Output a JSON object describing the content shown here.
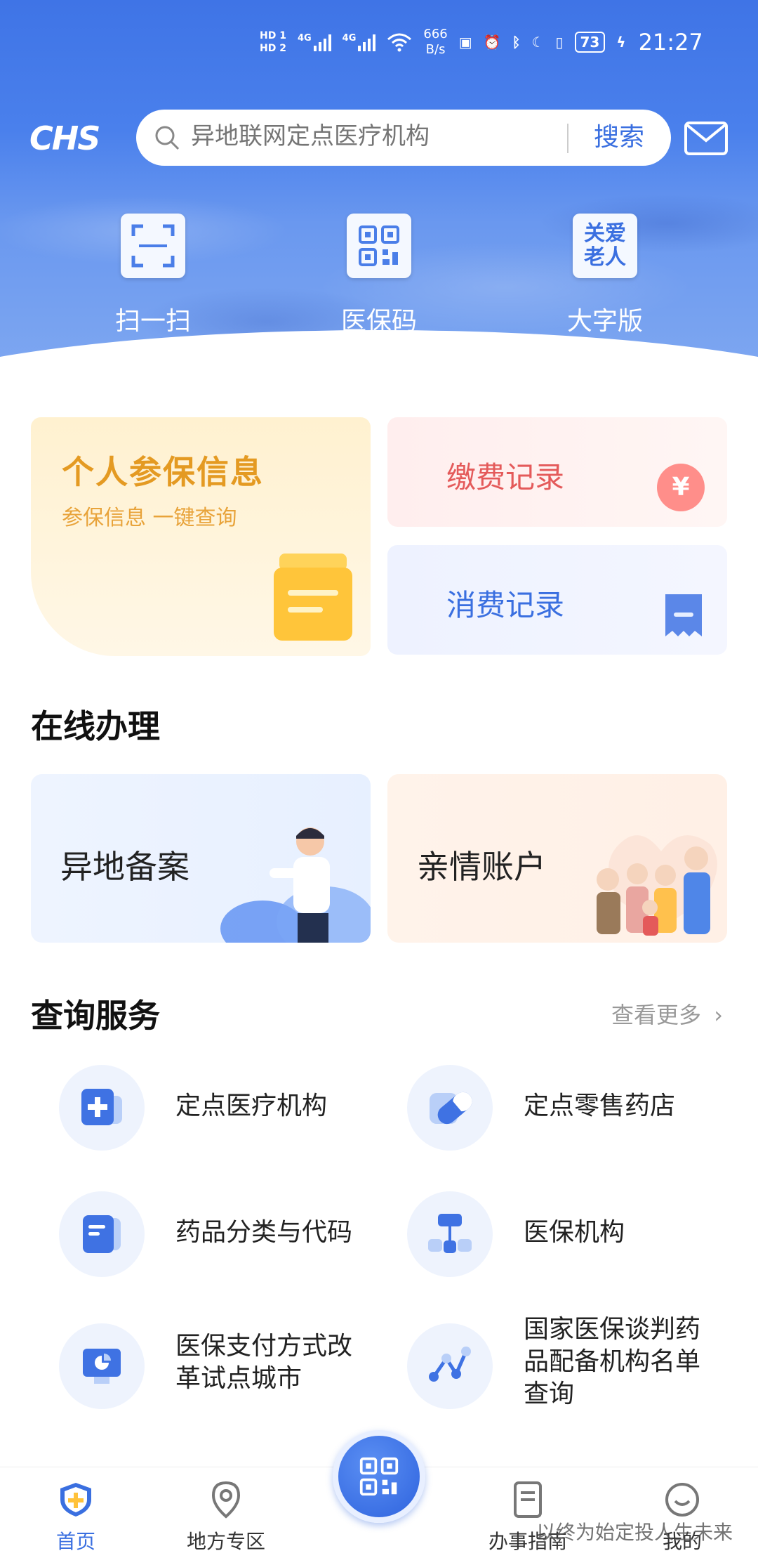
{
  "status_bar": {
    "hd1": "HD 1",
    "hd2": "HD 2",
    "net1": "4G",
    "net2": "4G",
    "speed_value": "666",
    "speed_unit": "B/s",
    "battery": "73",
    "time": "21:27"
  },
  "header": {
    "logo": "CHS",
    "search": {
      "placeholder": "异地联网定点医疗机构",
      "button": "搜索"
    }
  },
  "quick_actions": [
    {
      "label": "扫一扫"
    },
    {
      "label": "医保码"
    },
    {
      "label": "大字版",
      "tile_text_line1": "关爱",
      "tile_text_line2": "老人"
    }
  ],
  "cards": {
    "insurance_title": "个人参保信息",
    "insurance_sub": "参保信息 一键查询",
    "payment": "缴费记录",
    "payment_badge": "¥",
    "spending": "消费记录"
  },
  "online": {
    "title": "在线办理",
    "items": [
      {
        "label": "异地备案"
      },
      {
        "label": "亲情账户"
      }
    ]
  },
  "query": {
    "title": "查询服务",
    "more": "查看更多",
    "items": [
      {
        "line1": "定点医疗机构",
        "line2": "",
        "line3": ""
      },
      {
        "line1": "定点零售药店",
        "line2": "",
        "line3": ""
      },
      {
        "line1": "药品分类与代码",
        "line2": "",
        "line3": ""
      },
      {
        "line1": "医保机构",
        "line2": "",
        "line3": ""
      },
      {
        "line1": "医保支付方式改",
        "line2": "革试点城市",
        "line3": ""
      },
      {
        "line1": "国家医保谈判药",
        "line2": "品配备机构名单",
        "line3": "查询"
      }
    ]
  },
  "bottom_nav": [
    {
      "label": "首页"
    },
    {
      "label": "地方专区"
    },
    {
      "label": "办事指南"
    },
    {
      "label": "我的"
    }
  ],
  "watermark": "以终为始定投人生未来",
  "colors": {
    "primary": "#3a6fe0",
    "header": "#4a80ec",
    "insurance_gold": "#e49a22",
    "payment_red": "#e45a5a"
  }
}
